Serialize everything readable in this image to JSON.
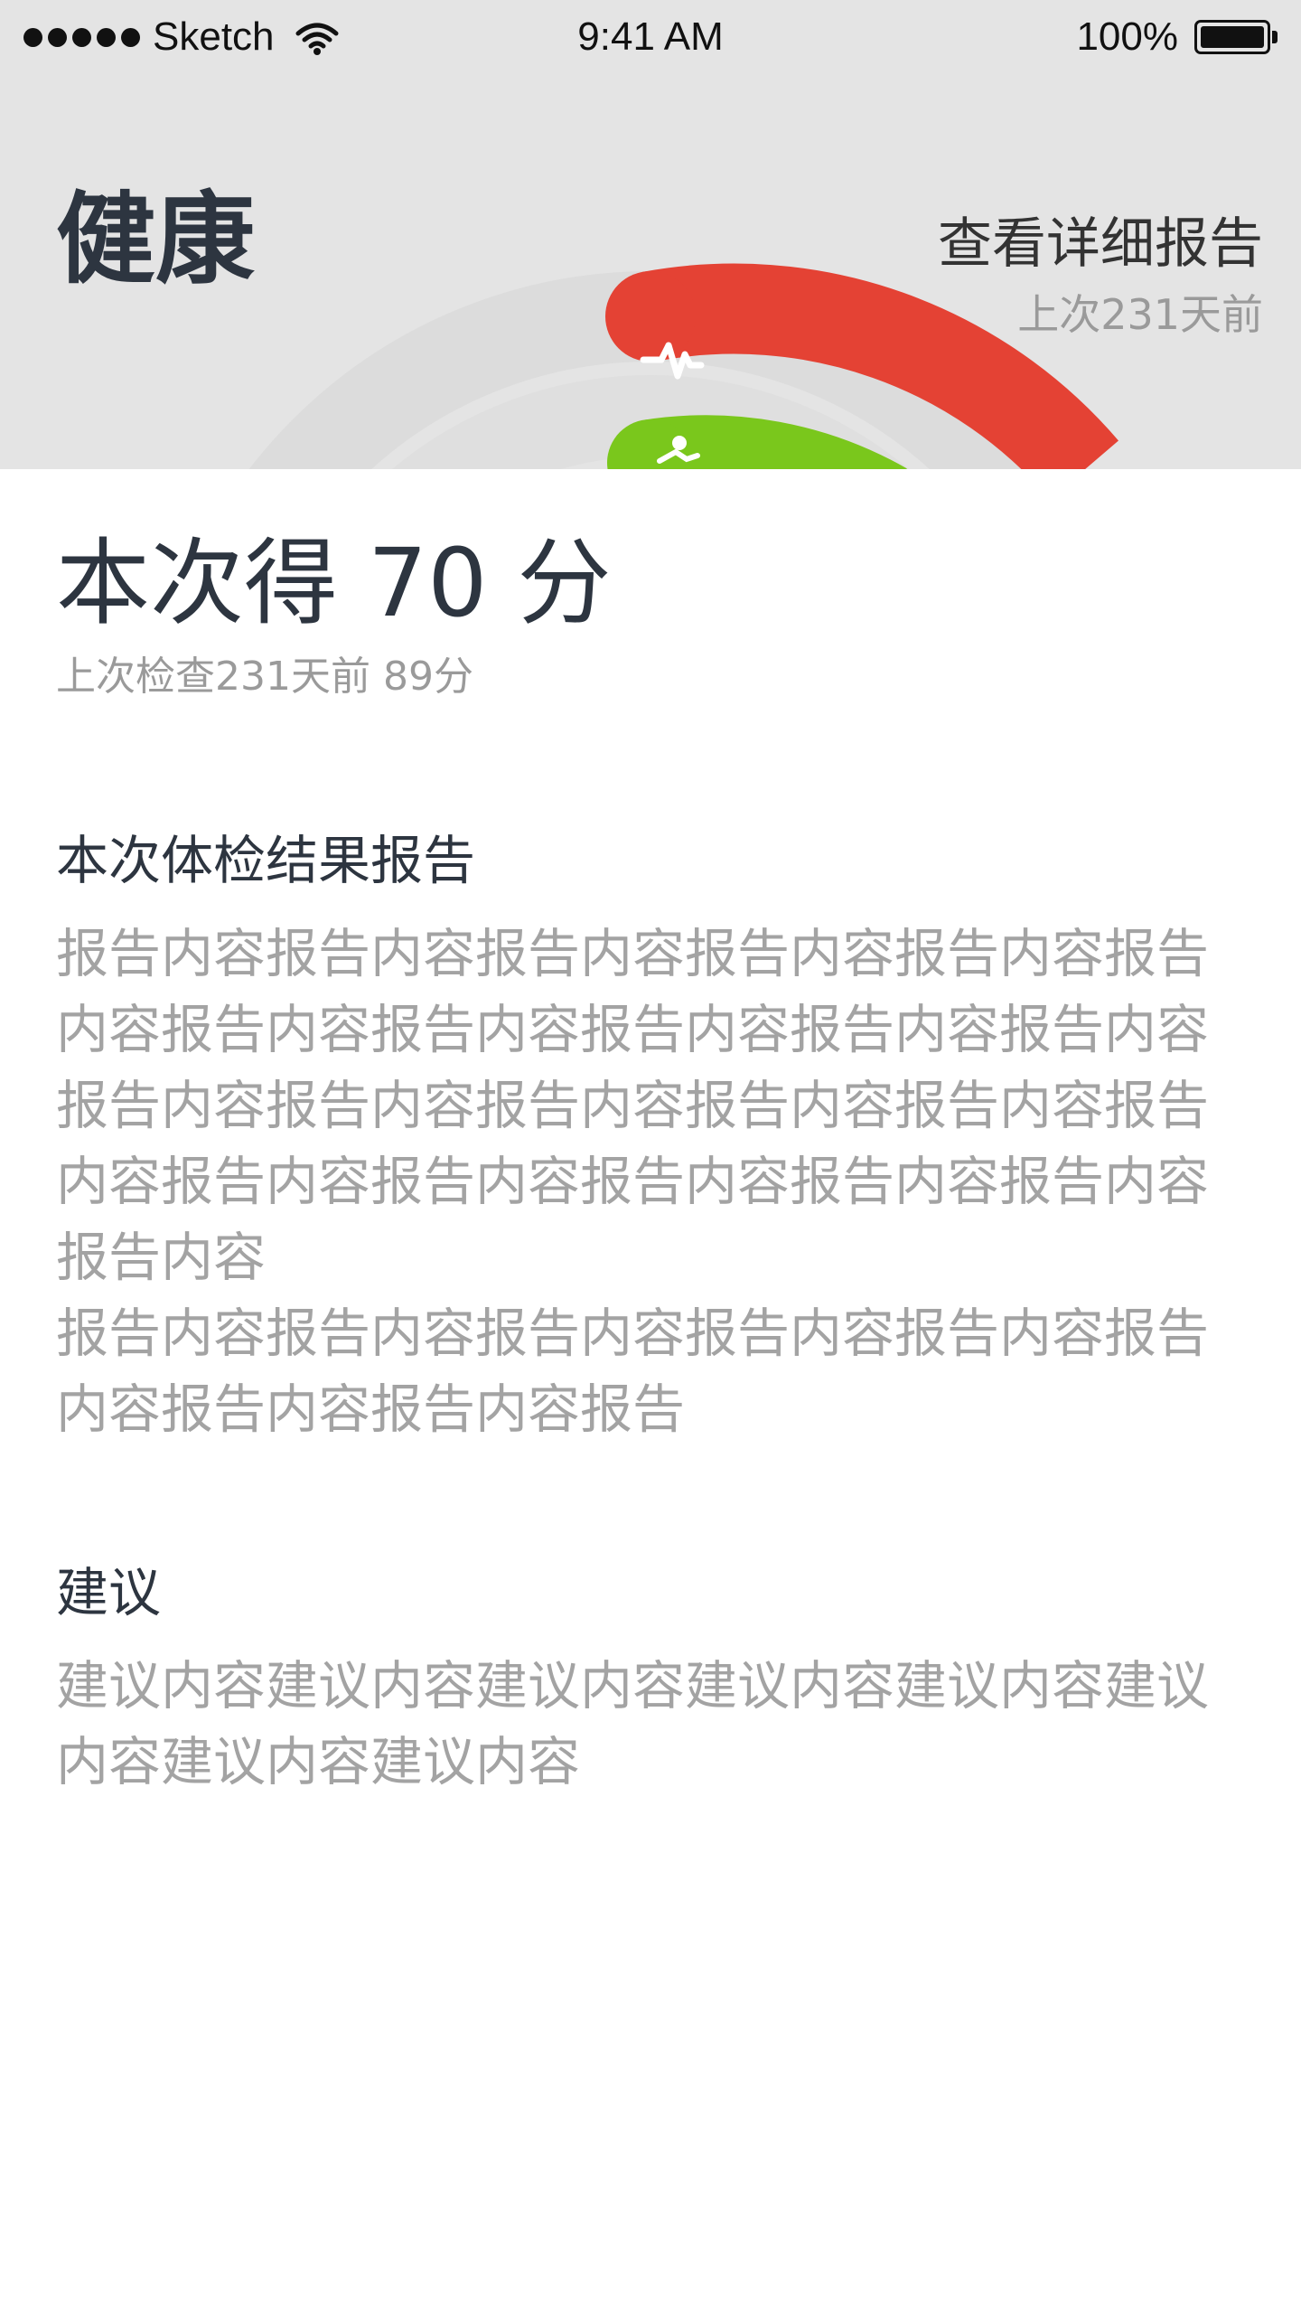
{
  "status_bar": {
    "carrier": "Sketch",
    "time": "9:41 AM",
    "battery": "100%"
  },
  "header": {
    "title": "健康",
    "report_link": "查看详细报告",
    "report_last": "上次231天前"
  },
  "rings": {
    "colors": {
      "heart": "#e44234",
      "activity": "#7ac71c",
      "track": "#d9d9d9"
    },
    "icons": [
      "heartbeat-icon",
      "running-icon"
    ]
  },
  "score": {
    "text": "本次得 70 分",
    "previous": "上次检查231天前 89分"
  },
  "report": {
    "title": "本次体检结果报告",
    "body": "报告内容报告内容报告内容报告内容报告内容报告内容报告内容报告内容报告内容报告内容报告内容报告内容报告内容报告内容报告内容报告内容报告内容报告内容报告内容报告内容报告内容报告内容报告内容\n报告内容报告内容报告内容报告内容报告内容报告内容报告内容报告内容报告"
  },
  "advice": {
    "title": "建议",
    "body": "建议内容建议内容建议内容建议内容建议内容建议内容建议内容建议内容"
  }
}
